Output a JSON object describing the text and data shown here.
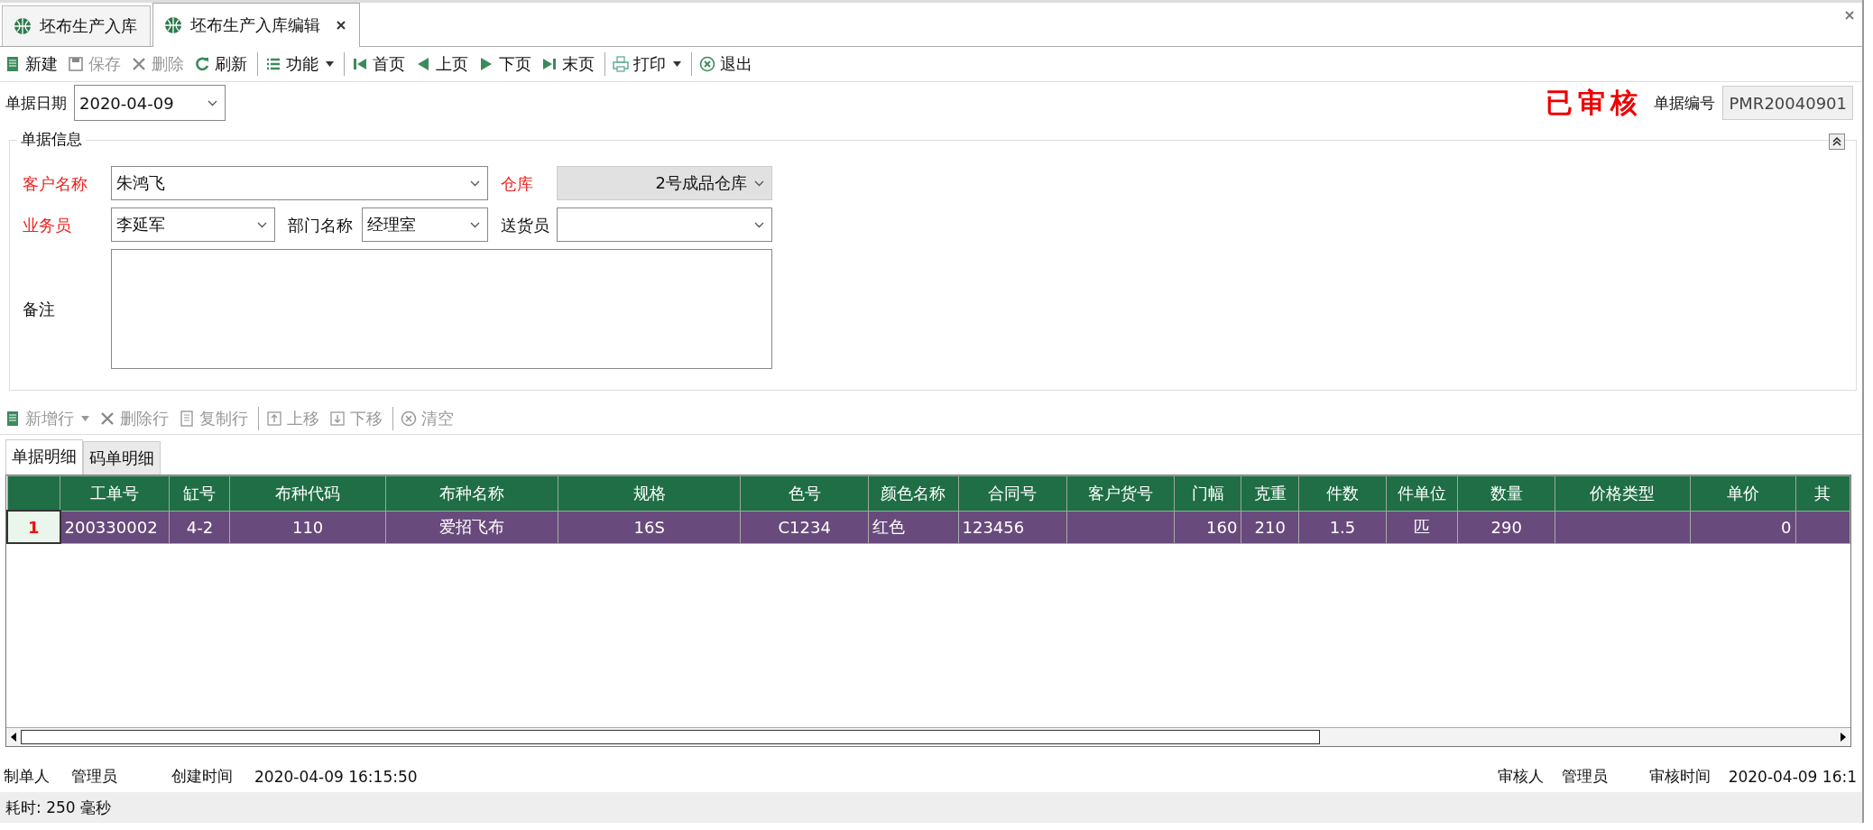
{
  "doc_tabs": [
    {
      "label": "坯布生产入库",
      "selected": false,
      "closable": false
    },
    {
      "label": "坯布生产入库编辑",
      "selected": true,
      "closable": true
    }
  ],
  "toolbar": [
    {
      "kind": "button",
      "label": "新建",
      "disabled": false
    },
    {
      "kind": "button",
      "label": "保存",
      "disabled": true
    },
    {
      "kind": "button",
      "label": "删除",
      "disabled": true
    },
    {
      "kind": "button",
      "label": "刷新",
      "disabled": false
    },
    {
      "kind": "sep"
    },
    {
      "kind": "menu",
      "label": "功能",
      "disabled": false
    },
    {
      "kind": "sep"
    },
    {
      "kind": "button",
      "label": "首页",
      "disabled": false
    },
    {
      "kind": "button",
      "label": "上页",
      "disabled": false
    },
    {
      "kind": "button",
      "label": "下页",
      "disabled": false
    },
    {
      "kind": "button",
      "label": "末页",
      "disabled": false
    },
    {
      "kind": "sep"
    },
    {
      "kind": "menu",
      "label": "打印",
      "disabled": false
    },
    {
      "kind": "sep"
    },
    {
      "kind": "button",
      "label": "退出",
      "disabled": false
    }
  ],
  "header": {
    "date_label": "单据日期",
    "date_value": "2020-04-09",
    "status_stamp": "已审核",
    "number_label": "单据编号",
    "number_value": "PMR20040901"
  },
  "info_group": {
    "title": "单据信息",
    "fields": [
      {
        "kind": "combo",
        "label": "客户名称",
        "value": "朱鸿飞",
        "required": true,
        "disabled": false
      },
      {
        "kind": "combo",
        "label": "仓库",
        "value": "2号成品仓库",
        "required": true,
        "disabled": true
      },
      {
        "kind": "combo",
        "label": "业务员",
        "value": "李延军",
        "required": true,
        "disabled": false
      },
      {
        "kind": "combo",
        "label": "部门名称",
        "value": "经理室",
        "required": false,
        "disabled": false
      },
      {
        "kind": "combo",
        "label": "送货员",
        "required": false,
        "disabled": false
      },
      {
        "kind": "memo",
        "label": "备注",
        "required": false,
        "disabled": false
      }
    ]
  },
  "detail_toolbar": [
    {
      "kind": "menu",
      "label": "新增行",
      "disabled": true
    },
    {
      "kind": "button",
      "label": "删除行",
      "disabled": true
    },
    {
      "kind": "button",
      "label": "复制行",
      "disabled": true
    },
    {
      "kind": "sep"
    },
    {
      "kind": "button",
      "label": "上移",
      "disabled": true
    },
    {
      "kind": "button",
      "label": "下移",
      "disabled": true
    },
    {
      "kind": "sep"
    },
    {
      "kind": "button",
      "label": "清空",
      "disabled": true
    }
  ],
  "detail_tabs": [
    {
      "label": "单据明细",
      "selected": true
    },
    {
      "label": "码单明细",
      "selected": false
    }
  ],
  "table": {
    "columns": [
      "工单号",
      "缸号",
      "布种代码",
      "布种名称",
      "规格",
      "色号",
      "颜色名称",
      "合同号",
      "客户货号",
      "门幅",
      "克重",
      "件数",
      "件单位",
      "数量",
      "价格类型",
      "单价",
      "其"
    ],
    "rows": [
      {
        "number": "1",
        "selected": true,
        "cells": [
          "200330002",
          "4-2",
          "110",
          "爱招飞布",
          "16S",
          "C1234",
          "红色",
          "123456",
          "",
          "160",
          "210",
          "1.5",
          "匹",
          "290",
          "",
          "0",
          ""
        ]
      }
    ]
  },
  "footer": {
    "left": [
      {
        "label": "制单人",
        "value": "管理员"
      },
      {
        "label": "创建时间",
        "value": "2020-04-09 16:15:50"
      }
    ],
    "right": [
      {
        "label": "审核人",
        "value": "管理员"
      },
      {
        "label": "审核时间",
        "value": "2020-04-09 16:1"
      }
    ]
  },
  "status_bar": "耗时: 250 毫秒"
}
